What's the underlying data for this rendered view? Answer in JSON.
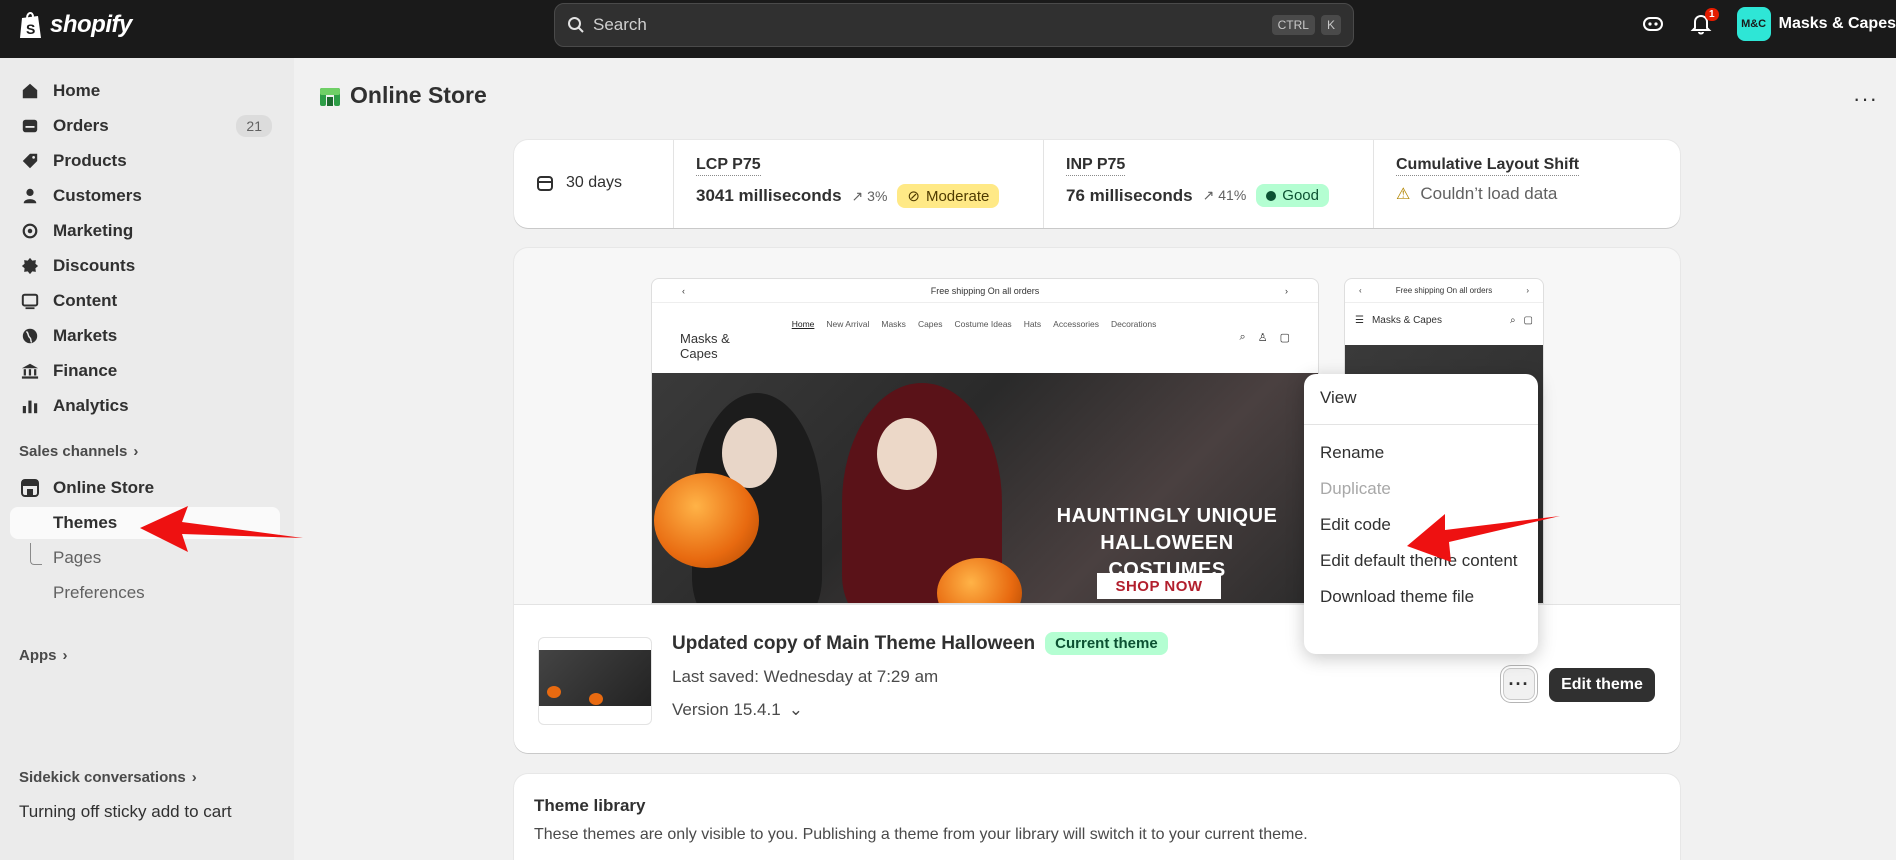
{
  "topbar": {
    "brand": "shopify",
    "search_placeholder": "Search",
    "shortcut": [
      "CTRL",
      "K"
    ],
    "notification_count": "1",
    "store_initials": "M&C",
    "store_name": "Masks & Capes"
  },
  "sidebar": {
    "items": [
      {
        "label": "Home",
        "icon": "home-icon"
      },
      {
        "label": "Orders",
        "icon": "orders-icon",
        "count": "21"
      },
      {
        "label": "Products",
        "icon": "tag-icon"
      },
      {
        "label": "Customers",
        "icon": "person-icon"
      },
      {
        "label": "Marketing",
        "icon": "target-icon"
      },
      {
        "label": "Discounts",
        "icon": "discount-icon"
      },
      {
        "label": "Content",
        "icon": "content-icon"
      },
      {
        "label": "Markets",
        "icon": "globe-icon"
      },
      {
        "label": "Finance",
        "icon": "bank-icon"
      },
      {
        "label": "Analytics",
        "icon": "chart-icon"
      }
    ],
    "sales_channels_label": "Sales channels",
    "online_store_label": "Online Store",
    "sub_items": [
      "Themes",
      "Pages",
      "Preferences"
    ],
    "apps_label": "Apps",
    "sidekick_label": "Sidekick conversations",
    "sidekick_item": "Turning off sticky add to cart"
  },
  "page": {
    "title": "Online Store"
  },
  "metrics": {
    "range": "30 days",
    "lcp": {
      "label": "LCP P75",
      "value": "3041 milliseconds",
      "trend": "3%",
      "status": "Moderate"
    },
    "inp": {
      "label": "INP P75",
      "value": "76 milliseconds",
      "trend": "41%",
      "status": "Good"
    },
    "cls": {
      "label": "Cumulative Layout Shift",
      "value": "Couldn’t load data"
    }
  },
  "preview": {
    "announcement": "Free shipping On all orders",
    "brand": "Masks & Capes",
    "nav": [
      "Home",
      "New Arrival",
      "Masks",
      "Capes",
      "Costume Ideas",
      "Hats",
      "Accessories",
      "Decorations"
    ],
    "hero_title_line1": "HAUNTINGLY UNIQUE",
    "hero_title_line2": "HALLOWEEN COSTUMES",
    "hero_cta": "SHOP NOW"
  },
  "theme": {
    "name": "Updated copy of Main Theme Halloween",
    "badge": "Current theme",
    "last_saved": "Last saved: Wednesday at 7:29 am",
    "version": "Version 15.4.1",
    "more_label": "···",
    "edit_label": "Edit theme"
  },
  "menu": {
    "view": "View",
    "rename": "Rename",
    "duplicate": "Duplicate",
    "edit_code": "Edit code",
    "edit_default": "Edit default theme content",
    "download": "Download theme file"
  },
  "library": {
    "title": "Theme library",
    "description": "These themes are only visible to you. Publishing a theme from your library will switch it to your current theme."
  },
  "colors": {
    "topbar": "#1a1a1a",
    "good": "#b4fed2",
    "moderate": "#ffe986",
    "annotation_arrow": "#ee1111",
    "store_avatar": "#2ee6d6"
  }
}
